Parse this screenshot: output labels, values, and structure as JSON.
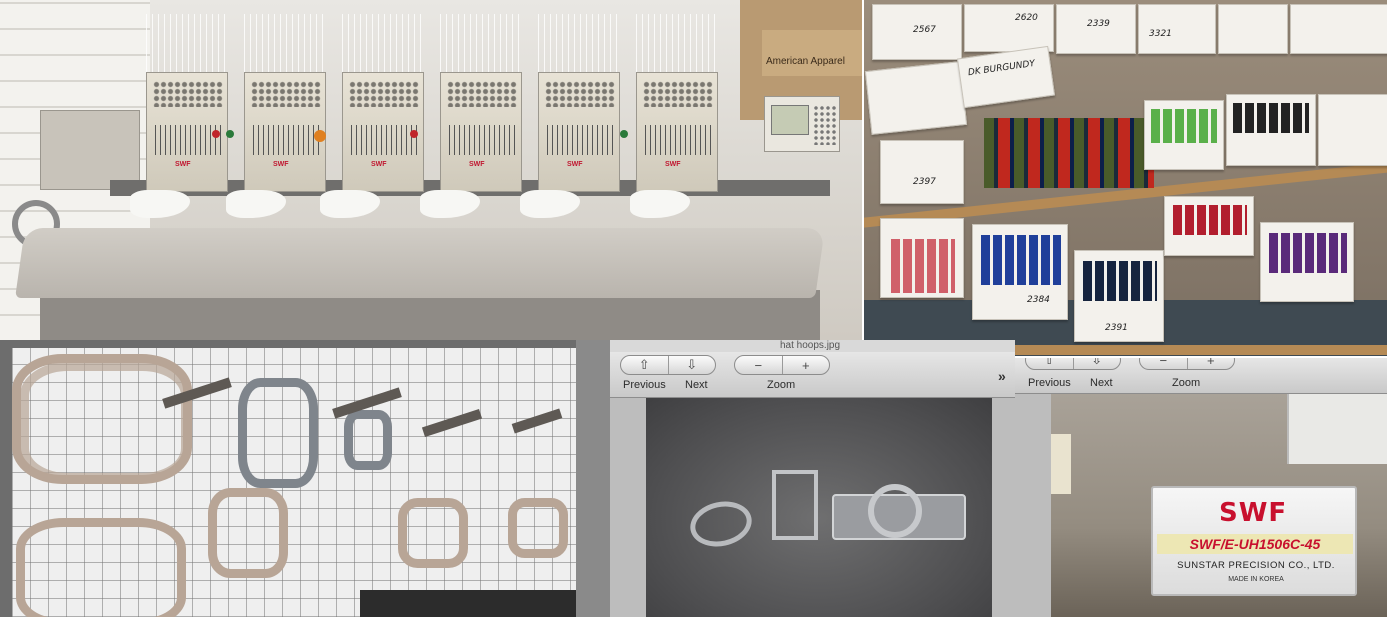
{
  "machine_photo": {
    "box_text": "American Apparel",
    "head_logo": "SWF"
  },
  "thread_photo": {
    "box_labels": [
      "2567",
      "2620",
      "2339",
      "3321",
      "DK BURGUNDY",
      "2397",
      "2384",
      "2391"
    ]
  },
  "viewer_window": {
    "file_name": "hat hoops.jpg",
    "toolbar": {
      "previous_label": "Previous",
      "next_label": "Next",
      "zoom_label": "Zoom",
      "zoom_out_symbol": "−",
      "zoom_in_symbol": "+",
      "overflow_symbol": "»"
    },
    "icons": [
      "arrow-up-icon",
      "arrow-down-icon",
      "minus-icon",
      "plus-icon",
      "chevron-double-right-icon"
    ]
  },
  "plate_viewer": {
    "toolbar": {
      "previous_label": "Previous",
      "next_label": "Next",
      "zoom_label": "Zoom"
    },
    "nameplate": {
      "logo": "SWF",
      "model": "SWF/E-UH1506C-45",
      "maker": "SUNSTAR   PRECISION CO., LTD.",
      "origin": "MADE IN KOREA"
    }
  },
  "colors": {
    "brand_red": "#c8102e",
    "toolbar_gray": "#d6d6d6",
    "shelf_wood": "#b58a55"
  }
}
